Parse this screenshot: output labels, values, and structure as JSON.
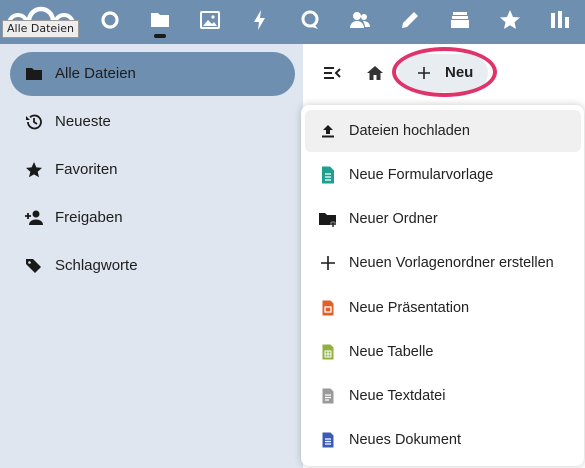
{
  "tooltip": "Alle Dateien",
  "topbar": {
    "apps": [
      {
        "name": "dashboard-icon"
      },
      {
        "name": "files-folder-icon",
        "active": true
      },
      {
        "name": "photos-icon"
      },
      {
        "name": "activity-lightning-icon"
      },
      {
        "name": "talk-icon"
      },
      {
        "name": "contacts-icon"
      },
      {
        "name": "notes-pencil-icon"
      },
      {
        "name": "deck-icon"
      },
      {
        "name": "favorites-star-icon"
      },
      {
        "name": "analytics-bar-icon"
      }
    ]
  },
  "sidebar": {
    "items": [
      {
        "label": "Alle Dateien",
        "icon": "folder-icon",
        "active": true
      },
      {
        "label": "Neueste",
        "icon": "history-clock-icon"
      },
      {
        "label": "Favoriten",
        "icon": "star-icon"
      },
      {
        "label": "Freigaben",
        "icon": "share-person-icon"
      },
      {
        "label": "Schlagworte",
        "icon": "tag-icon"
      }
    ]
  },
  "toolbar": {
    "new_label": "Neu"
  },
  "new_menu": {
    "items": [
      {
        "label": "Dateien hochladen",
        "icon": "upload-icon"
      },
      {
        "label": "Neue Formularvorlage",
        "icon": "form-template-icon"
      },
      {
        "label": "Neuer Ordner",
        "icon": "new-folder-icon"
      },
      {
        "label": "Neuen Vorlagenordner erstellen",
        "icon": "plus-icon"
      },
      {
        "label": "Neue Präsentation",
        "icon": "presentation-icon"
      },
      {
        "label": "Neue Tabelle",
        "icon": "spreadsheet-icon"
      },
      {
        "label": "Neue Textdatei",
        "icon": "text-file-icon"
      },
      {
        "label": "Neues Dokument",
        "icon": "document-icon"
      }
    ]
  },
  "colors": {
    "header": "#6f8fb1",
    "highlight_ring": "#e0336a",
    "presentation": "#e0602b",
    "spreadsheet": "#8fb140",
    "document": "#3b5bb5",
    "form": "#1ea091"
  }
}
